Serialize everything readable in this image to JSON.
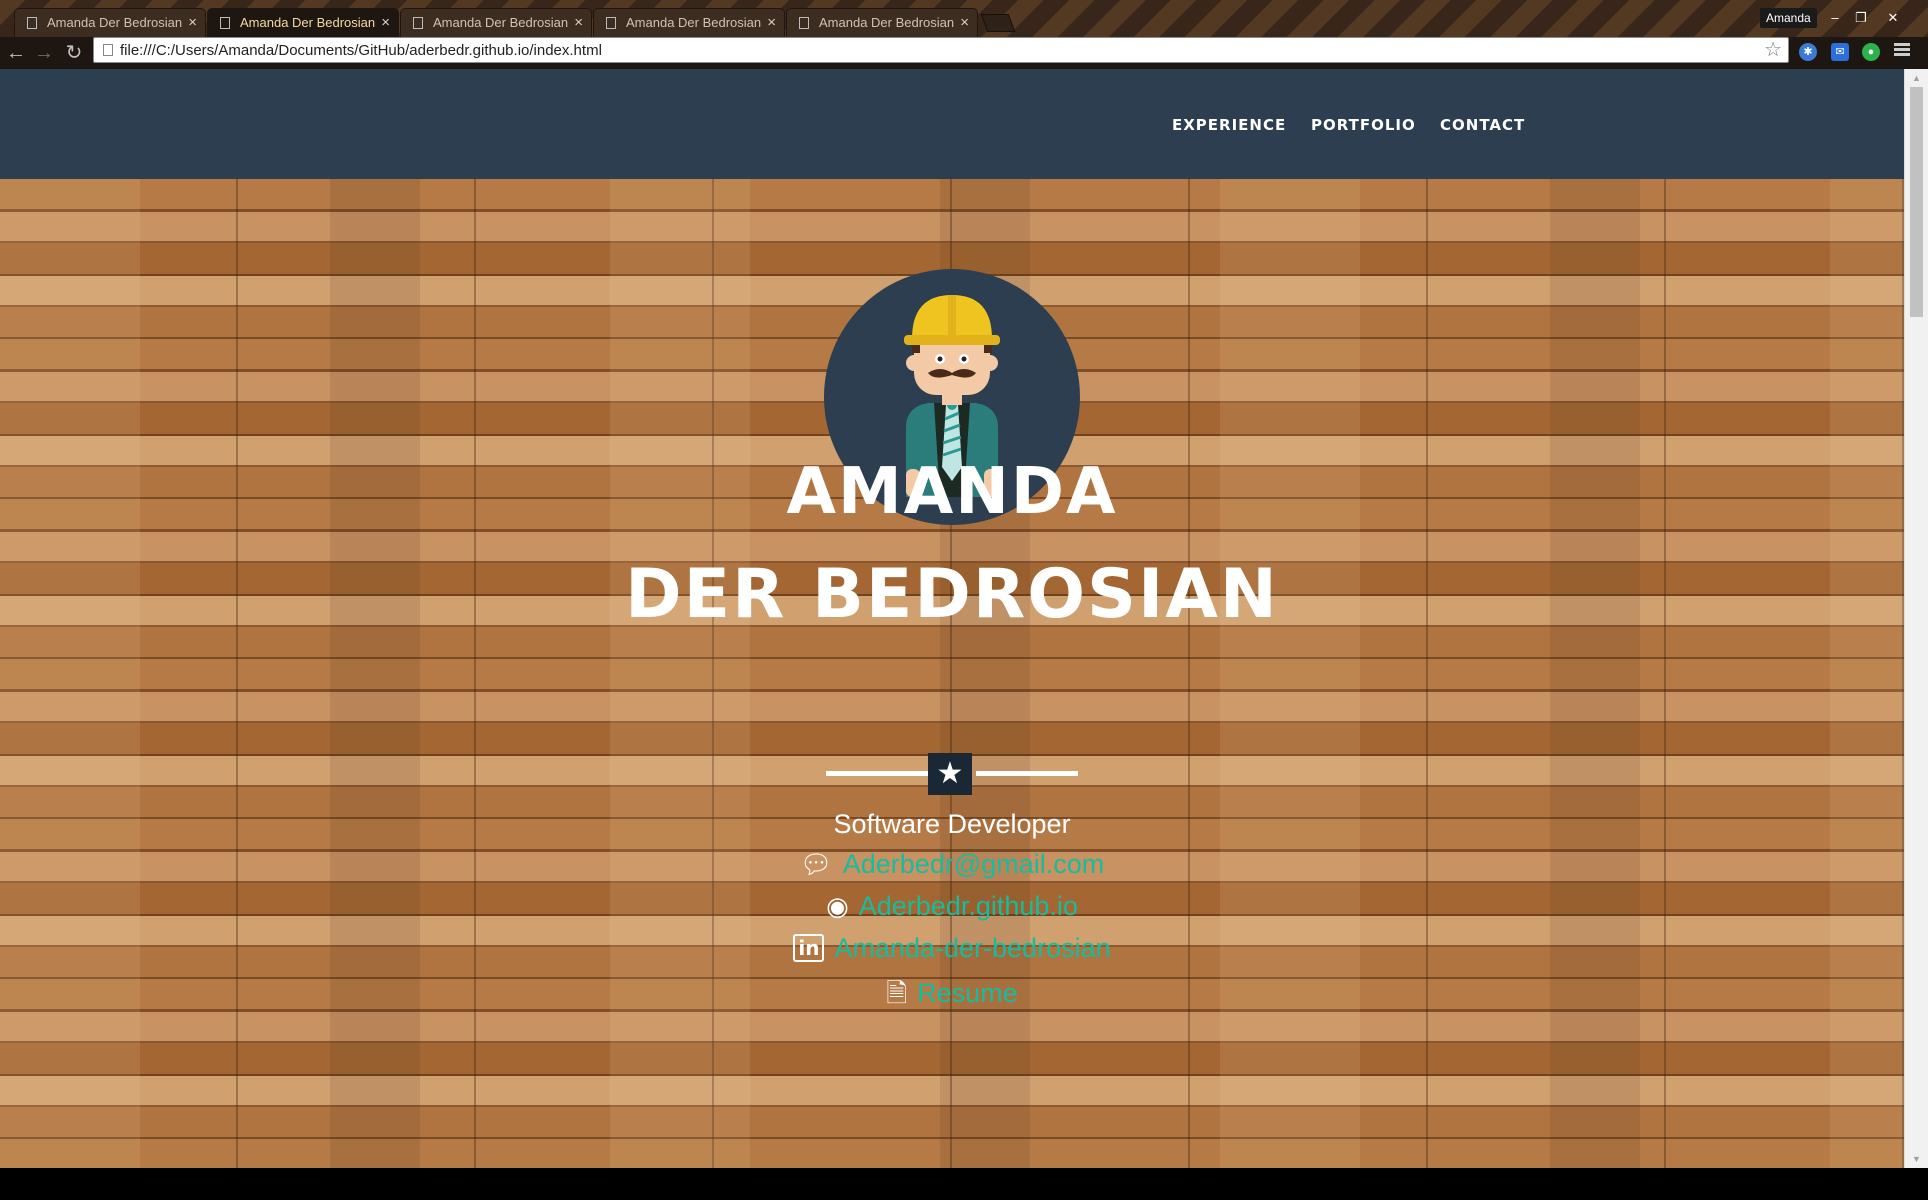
{
  "browser": {
    "tabs": [
      {
        "title": "Amanda Der Bedrosian",
        "active": false
      },
      {
        "title": "Amanda Der Bedrosian",
        "active": true
      },
      {
        "title": "Amanda Der Bedrosian",
        "active": false
      },
      {
        "title": "Amanda Der Bedrosian",
        "active": false
      },
      {
        "title": "Amanda Der Bedrosian",
        "active": false
      }
    ],
    "profile_name": "Amanda",
    "url": "file:///C:/Users/Amanda/Documents/GitHub/aderbedr.github.io/index.html",
    "icons": {
      "back": "arrow-left-icon",
      "forward": "arrow-right-icon",
      "reload": "reload-icon",
      "bookmark": "star-outline-icon",
      "menu": "hamburger-icon"
    }
  },
  "nav": {
    "experience": "EXPERIENCE",
    "portfolio": "PORTFOLIO",
    "contact": "CONTACT"
  },
  "hero": {
    "name_line1": "AMANDA",
    "name_line2": "DER BEDROSIAN",
    "subtitle": "Software Developer",
    "divider_icon": "star-icon"
  },
  "contacts": [
    {
      "icon": "chat-bubbles-icon",
      "label": "Aderbedr@gmail.com"
    },
    {
      "icon": "github-icon",
      "label": "Aderbedr.github.io"
    },
    {
      "icon": "linkedin-icon",
      "label": "Amanda-der-bedrosian"
    },
    {
      "icon": "pdf-file-icon",
      "label": "Resume"
    }
  ],
  "colors": {
    "navbar": "#2c3e50",
    "link": "#18bc9c",
    "star_box": "#1a2735"
  }
}
